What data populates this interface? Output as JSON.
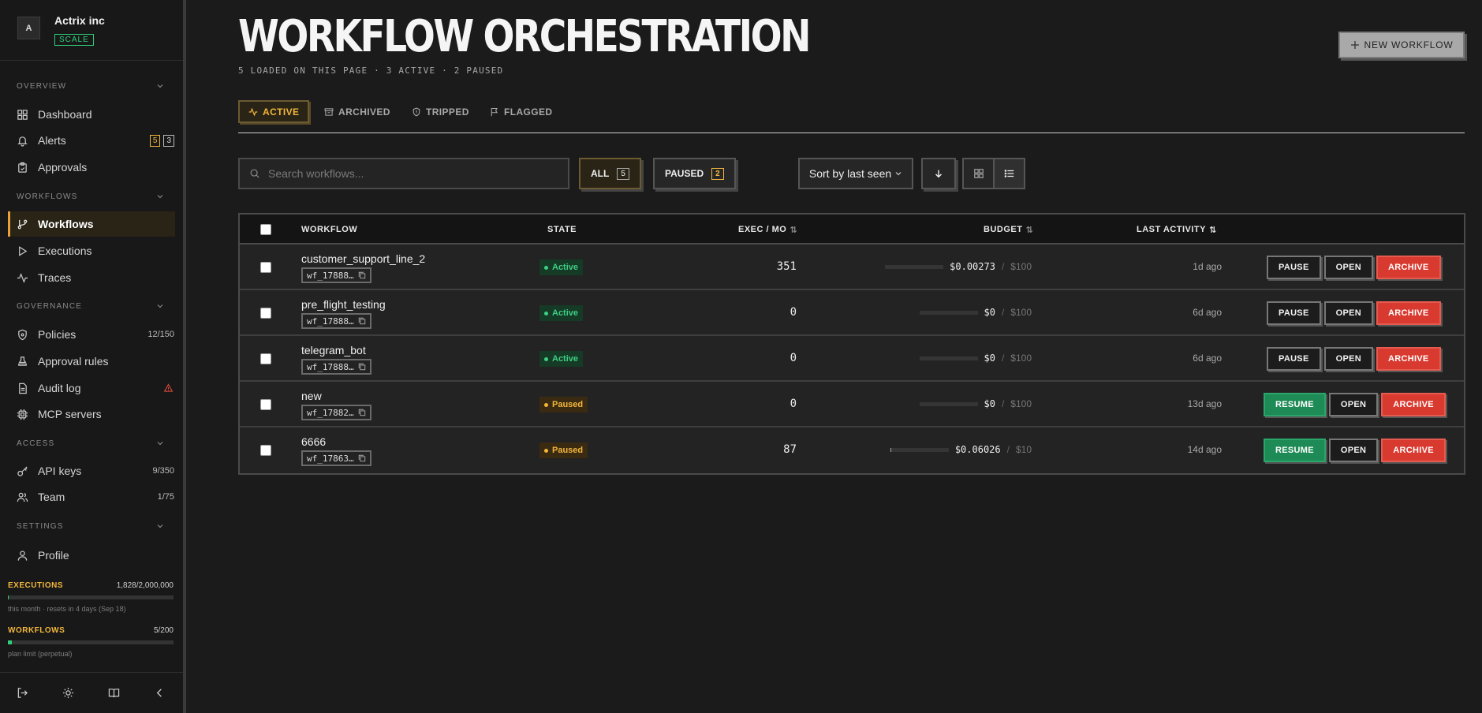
{
  "org": {
    "avatar": "A",
    "name": "Actrix inc",
    "plan": "SCALE"
  },
  "sidebar": {
    "sections": {
      "overview": "OVERVIEW",
      "workflows": "WORKFLOWS",
      "governance": "GOVERNANCE",
      "access": "ACCESS",
      "settings": "SETTINGS"
    },
    "items": {
      "dashboard": "Dashboard",
      "alerts": "Alerts",
      "alerts_count_a": "5",
      "alerts_count_b": "3",
      "approvals": "Approvals",
      "workflows": "Workflows",
      "executions": "Executions",
      "traces": "Traces",
      "policies": "Policies",
      "policies_count": "12/150",
      "approval_rules": "Approval rules",
      "audit_log": "Audit log",
      "mcp_servers": "MCP servers",
      "api_keys": "API keys",
      "api_keys_count": "9/350",
      "team": "Team",
      "team_count": "1/75",
      "profile": "Profile"
    },
    "usage": {
      "executions_label": "EXECUTIONS",
      "executions_value": "1,828/2,000,000",
      "executions_note": "this month · resets in 4 days (Sep 18)",
      "executions_fraction": 0.0009,
      "workflows_label": "WORKFLOWS",
      "workflows_value": "5/200",
      "workflows_note": "plan limit (perpetual)",
      "workflows_fraction": 0.025
    }
  },
  "header": {
    "title": "WORKFLOW ORCHESTRATION",
    "subtitle": "5 LOADED ON THIS PAGE · 3 ACTIVE · 2 PAUSED",
    "new_button": "NEW WORKFLOW"
  },
  "tabs": {
    "active": "ACTIVE",
    "archived": "ARCHIVED",
    "tripped": "TRIPPED",
    "flagged": "FLAGGED"
  },
  "toolbar": {
    "search_placeholder": "Search workflows...",
    "all_label": "ALL",
    "all_count": "5",
    "paused_label": "PAUSED",
    "paused_count": "2",
    "sort_label": "Sort by last seen"
  },
  "table": {
    "headers": {
      "workflow": "WORKFLOW",
      "state": "STATE",
      "exec": "EXEC / MO",
      "budget": "BUDGET",
      "last_activity": "LAST ACTIVITY"
    },
    "rows": [
      {
        "name": "customer_support_line_2",
        "id": "wf_17888…",
        "state": "Active",
        "exec": "351",
        "budget_amt": "$0.00273",
        "budget_cap": "$100",
        "budget_fraction": 0.0,
        "last": "1d ago",
        "primary": "PAUSE",
        "open": "OPEN",
        "archive": "ARCHIVE"
      },
      {
        "name": "pre_flight_testing",
        "id": "wf_17888…",
        "state": "Active",
        "exec": "0",
        "budget_amt": "$0",
        "budget_cap": "$100",
        "budget_fraction": 0.0,
        "last": "6d ago",
        "primary": "PAUSE",
        "open": "OPEN",
        "archive": "ARCHIVE"
      },
      {
        "name": "telegram_bot",
        "id": "wf_17888…",
        "state": "Active",
        "exec": "0",
        "budget_amt": "$0",
        "budget_cap": "$100",
        "budget_fraction": 0.0,
        "last": "6d ago",
        "primary": "PAUSE",
        "open": "OPEN",
        "archive": "ARCHIVE"
      },
      {
        "name": "new",
        "id": "wf_17882…",
        "state": "Paused",
        "exec": "0",
        "budget_amt": "$0",
        "budget_cap": "$100",
        "budget_fraction": 0.0,
        "last": "13d ago",
        "primary": "RESUME",
        "open": "OPEN",
        "archive": "ARCHIVE"
      },
      {
        "name": "6666",
        "id": "wf_17863…",
        "state": "Paused",
        "exec": "87",
        "budget_amt": "$0.06026",
        "budget_cap": "$10",
        "budget_fraction": 0.006,
        "last": "14d ago",
        "primary": "RESUME",
        "open": "OPEN",
        "archive": "ARCHIVE"
      }
    ]
  },
  "colors": {
    "accent": "#f2b63c",
    "active": "#3fcf83",
    "danger": "#d93a2f",
    "resume": "#1e8a55"
  }
}
